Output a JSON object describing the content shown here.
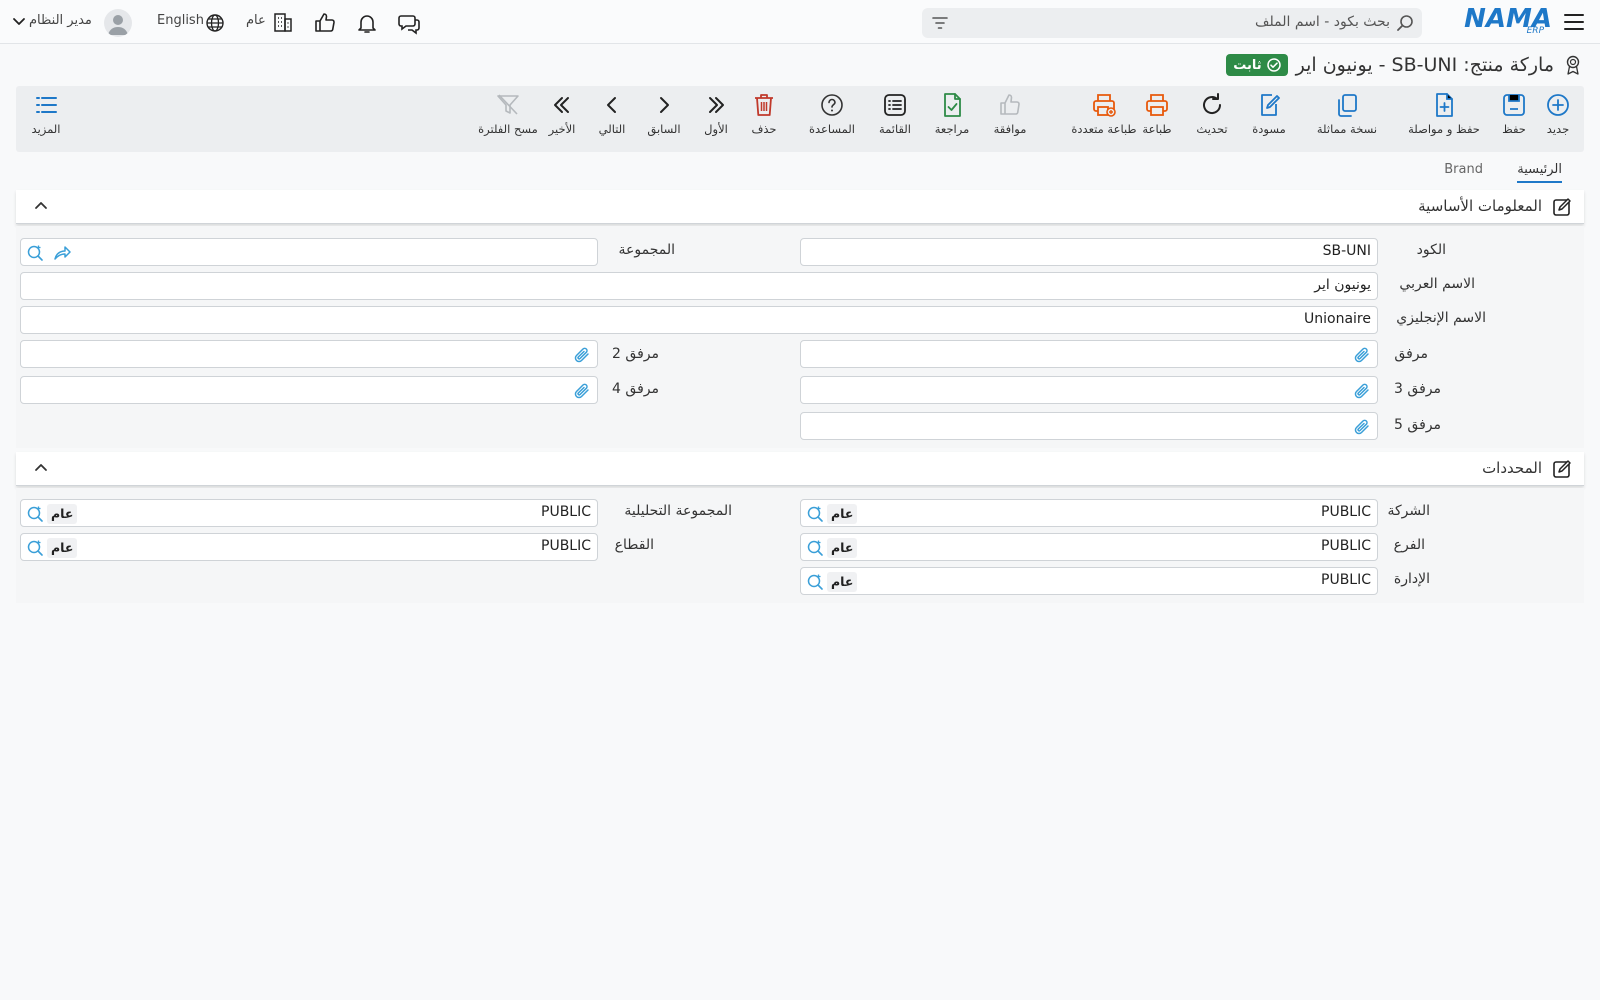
{
  "topbar": {
    "logo_main": "NAMA",
    "logo_sub": "ERP",
    "search_placeholder": "بحث بكود - اسم الملف",
    "branch_label": "عام",
    "language_label": "English",
    "user_name": "مدير النظام"
  },
  "header": {
    "title": "ماركة منتج: SB-UNI - يونيون اير",
    "status_badge": "ثابت",
    "status_color": "#2e8b47"
  },
  "toolbar": {
    "new": "جديد",
    "save": "حفظ",
    "save_continue": "حفظ و مواصلة",
    "duplicate": "نسخة مماثلة",
    "draft": "مسودة",
    "refresh": "تحديث",
    "print": "طباعة",
    "multi_print": "طباعة متعددة",
    "approve": "موافقة",
    "review": "مراجعة",
    "list": "القائمة",
    "help": "المساعدة",
    "delete": "حذف",
    "first": "الأول",
    "previous": "السابق",
    "next": "التالي",
    "last": "الأخير",
    "clear_filter": "مسح الفلترة",
    "more": "المزيد"
  },
  "tabs": {
    "main": "الرئيسية",
    "brand": "Brand"
  },
  "basic_info": {
    "title": "المعلومات الأساسية",
    "code_label": "الكود",
    "code_value": "SB-UNI",
    "group_label": "المجموعة",
    "arabic_name_label": "الاسم العربي",
    "arabic_name_value": "يونيون اير",
    "english_name_label": "الاسم الإنجليزي",
    "english_name_value": "Unionaire",
    "attachment_label": "مرفق",
    "attachment2_label": "مرفق 2",
    "attachment3_label": "مرفق 3",
    "attachment4_label": "مرفق 4",
    "attachment5_label": "مرفق 5"
  },
  "dimensions": {
    "title": "المحددات",
    "company_label": "الشركة",
    "company_value": "PUBLIC",
    "company_tag": "عام",
    "analytic_group_label": "المجموعة التحليلية",
    "analytic_group_value": "PUBLIC",
    "analytic_group_tag": "عام",
    "branch_label": "الفرع",
    "branch_value": "PUBLIC",
    "branch_tag": "عام",
    "sector_label": "القطاع",
    "sector_value": "PUBLIC",
    "sector_tag": "عام",
    "department_label": "الإدارة",
    "department_value": "PUBLIC",
    "department_tag": "عام"
  },
  "icon_names": [
    "menu-icon",
    "search-icon",
    "filter-icon",
    "chat-icon",
    "bell-icon",
    "thumbs-up-icon",
    "building-icon",
    "globe-icon",
    "user-icon",
    "chevron-down-icon",
    "award-icon",
    "check-circle-icon",
    "plus-circle-icon",
    "save-icon",
    "file-plus-icon",
    "copy-icon",
    "edit-icon",
    "refresh-icon",
    "printer-icon",
    "multi-printer-icon",
    "file-check-icon",
    "list-icon",
    "help-icon",
    "trash-icon",
    "double-chevron-left-icon",
    "chevron-left-icon",
    "chevron-right-icon",
    "double-chevron-right-icon",
    "filter-off-icon",
    "more-list-icon",
    "edit-square-icon",
    "chevron-up-icon",
    "paperclip-icon",
    "lookup-icon",
    "share-icon"
  ]
}
